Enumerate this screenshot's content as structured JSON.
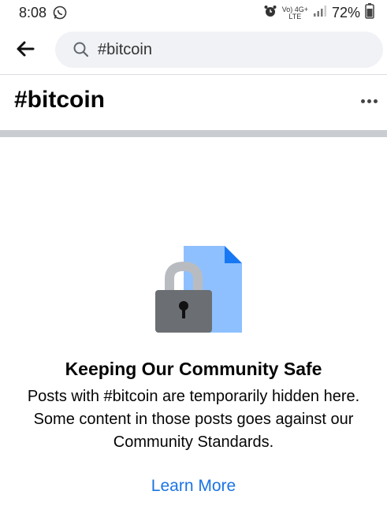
{
  "status_bar": {
    "time": "8:08",
    "net_top": "Vo) 4G+",
    "net_bottom": "LTE",
    "battery": "72%"
  },
  "search": {
    "query": "#bitcoin"
  },
  "page": {
    "title": "#bitcoin"
  },
  "notice": {
    "title": "Keeping Our Community Safe",
    "body": "Posts with #bitcoin are temporarily hidden here. Some content in those posts goes against our Community Standards.",
    "link": "Learn More"
  },
  "colors": {
    "link": "#1b74e4",
    "search_bg": "#f0f2f5",
    "doc_blue": "#8ec0ff",
    "doc_corner": "#1877f2",
    "lock_body": "#6b6e72",
    "lock_shackle": "#b8bcc1"
  }
}
